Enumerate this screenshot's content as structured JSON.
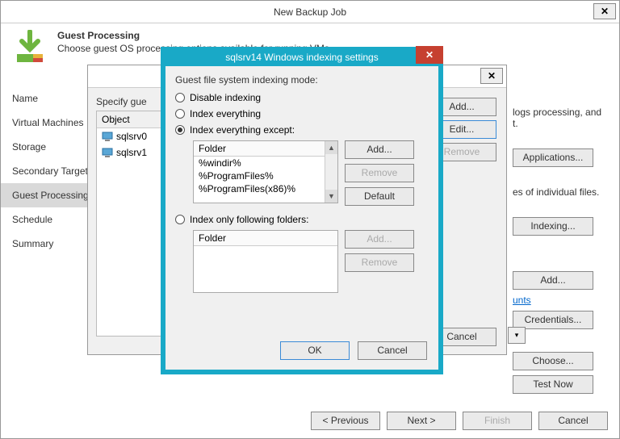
{
  "mainWindow": {
    "title": "New Backup Job",
    "closeGlyph": "✕",
    "header": {
      "title": "Guest Processing",
      "subtitle": "Choose guest OS processing options available for running VMs."
    },
    "nav": [
      "Name",
      "Virtual Machines",
      "Storage",
      "Secondary Target",
      "Guest Processing",
      "Schedule",
      "Summary"
    ],
    "rightText1a": "logs processing, and",
    "rightText1b": "t.",
    "rightText2": "es of individual files.",
    "btnApplications": "Applications...",
    "btnIndexing": "Indexing...",
    "btnAdd": "Add...",
    "btnCredentials": "Credentials...",
    "btnChoose": "Choose...",
    "btnTestNow": "Test Now",
    "linkAccounts": "unts",
    "footer": {
      "prev": "< Previous",
      "next": "Next >",
      "finish": "Finish",
      "cancel": "Cancel"
    }
  },
  "midDialog": {
    "closeGlyph": "✕",
    "specifyLabel": "Specify gue",
    "objectHeader": "Object",
    "objects": [
      "sqlsrv0",
      "sqlsrv1"
    ],
    "btnAdd": "Add...",
    "btnEdit": "Edit...",
    "btnRemove": "Remove",
    "btnCancel": "Cancel"
  },
  "indexDialog": {
    "title": "sqlsrv14 Windows indexing settings",
    "closeGlyph": "✕",
    "modeLabel": "Guest file system indexing mode:",
    "opt1": "Disable indexing",
    "opt2": "Index everything",
    "opt3": "Index everything except:",
    "opt4": "Index only following folders:",
    "folderHeader": "Folder",
    "exceptFolders": [
      "%windir%",
      "%ProgramFiles%",
      "%ProgramFiles(x86)%"
    ],
    "btnAdd": "Add...",
    "btnRemove": "Remove",
    "btnDefault": "Default",
    "btnOK": "OK",
    "btnCancel": "Cancel"
  }
}
